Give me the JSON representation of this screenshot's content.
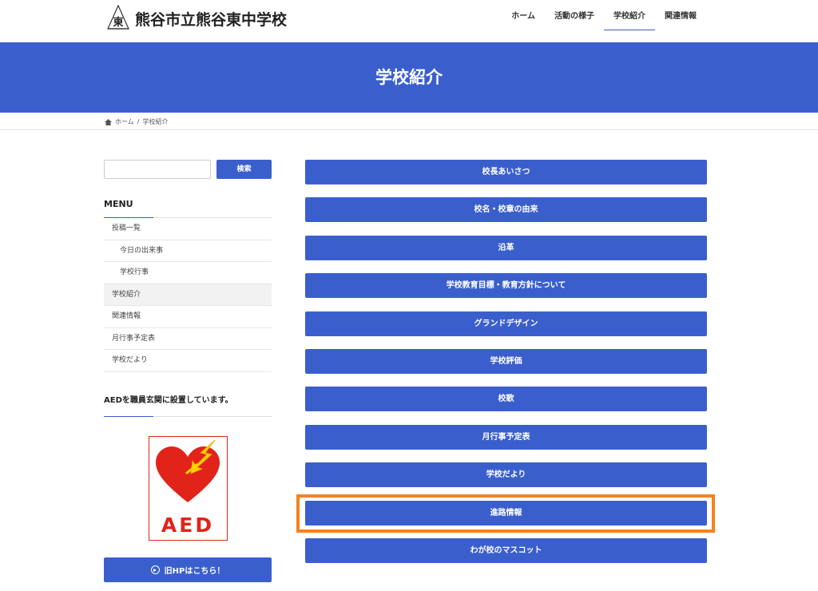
{
  "header": {
    "site_title": "熊谷市立熊谷東中学校",
    "logo_mark": "東",
    "nav": [
      "ホーム",
      "活動の様子",
      "学校紹介",
      "関連情報"
    ],
    "nav_active_index": 2
  },
  "hero": {
    "title": "学校紹介"
  },
  "breadcrumb": {
    "home": "ホーム",
    "separator": "/",
    "current": "学校紹介"
  },
  "sidebar": {
    "search_button": "検索",
    "search_placeholder": "",
    "menu_title": "MENU",
    "menu_items": [
      {
        "label": "投稿一覧",
        "level": 0
      },
      {
        "label": "今日の出来事",
        "level": 1
      },
      {
        "label": "学校行事",
        "level": 1
      },
      {
        "label": "学校紹介",
        "level": 0,
        "active": true
      },
      {
        "label": "関連情報",
        "level": 0
      },
      {
        "label": "月行事予定表",
        "level": 0
      },
      {
        "label": "学校だより",
        "level": 0
      }
    ],
    "aed_title": "AEDを職員玄関に設置しています。",
    "aed_label": "AED",
    "old_hp_button": "旧HPはこちら！"
  },
  "main": {
    "links": [
      "校長あいさつ",
      "校名・校章の由来",
      "沿革",
      "学校教育目標・教育方針について",
      "グランドデザイン",
      "学校評価",
      "校歌",
      "月行事予定表",
      "学校だより",
      "進路情報",
      "わが校のマスコット"
    ],
    "highlighted_index": 9
  },
  "colors": {
    "primary": "#3a5fcd",
    "highlight": "#f5821f",
    "aed_red": "#e2231a"
  },
  "icons": [
    "home-icon",
    "arrow-circle-right-icon",
    "heart-lightning-icon",
    "school-emblem-icon"
  ]
}
